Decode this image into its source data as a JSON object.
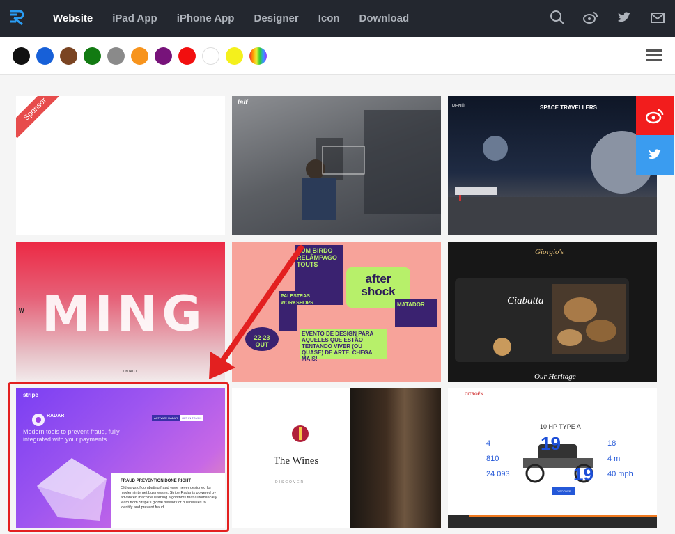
{
  "nav": {
    "links": [
      "Website",
      "iPad App",
      "iPhone App",
      "Designer",
      "Icon",
      "Download"
    ],
    "active": "Website",
    "icons": [
      "search-icon",
      "weibo-icon",
      "twitter-icon",
      "mail-icon"
    ]
  },
  "colors": [
    "#111111",
    "#1760d8",
    "#7a4422",
    "#127a12",
    "#8a8a8a",
    "#f7941d",
    "#77137a",
    "#f20f0f",
    "#ffffff",
    "#f4f01c",
    "rainbow"
  ],
  "tiles": {
    "t1": {
      "ribbon": "Sponsor"
    },
    "t2": {
      "brand": "laif"
    },
    "t3": {
      "title": "SPACE TRAVELLERS",
      "menu": "MENÜ"
    },
    "t4": {
      "word": "MING",
      "letter": "W",
      "footer": "CONTACT"
    },
    "t5": {
      "after": "after",
      "shock": "shock",
      "words": "PUM BIRDO RELÂMPAGO TOUTS",
      "event": "EVENTO DE DESIGN PARA AQUELES QUE ESTÃO TENTANDO VIVER (OU QUASE) DE ARTE. CHEGA MAIS!",
      "dates": "22-23 OUT",
      "side": "PALESTRAS WORKSHOPS",
      "place": "MATADOR"
    },
    "t6": {
      "brand": "Giorgio's",
      "product": "Ciabatta",
      "footer": "Our Heritage"
    },
    "t7": {
      "logo": "stripe",
      "product": "RADAR",
      "headline": "Modern tools to prevent fraud, fully integrated with your payments.",
      "subhead": "FRAUD PREVENTION DONE RIGHT",
      "body": "Old ways of combating fraud were never designed for modern internet businesses. Stripe Radar is powered by advanced machine learning algorithms that automatically learn from Stripe's global network of businesses to identify and prevent fraud.",
      "btn1": "ACTIVATE RADAR",
      "btn2": "GET IN TOUCH"
    },
    "t8": {
      "title": "The Wines",
      "discover": "DISCOVER"
    },
    "t9": {
      "brand": "CITROËN",
      "heading": "10 HP TYPE A",
      "num1": "4",
      "num2": "810",
      "num3": "24 093",
      "num4": "18",
      "num5": "4 m",
      "num6": "40 mph",
      "big1": "19",
      "big2": "19",
      "btn": "DISCOVER"
    }
  },
  "share": [
    "weibo-icon",
    "twitter-icon"
  ]
}
